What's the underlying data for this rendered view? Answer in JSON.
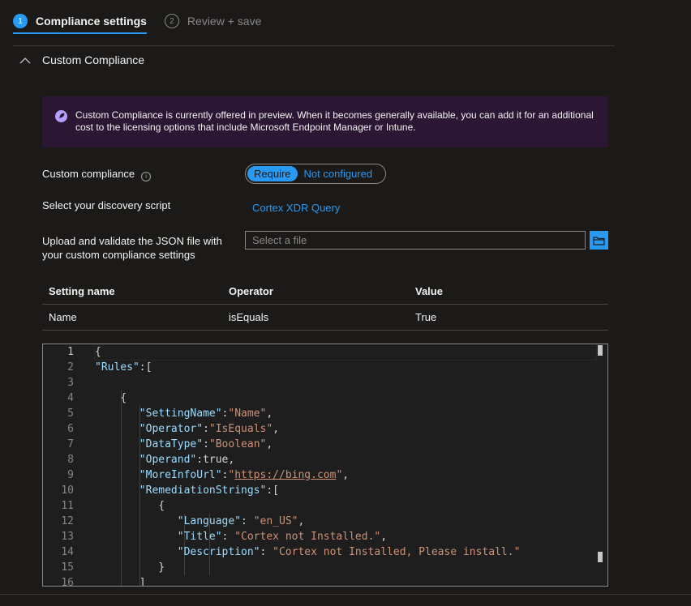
{
  "wizard": {
    "steps": [
      {
        "number": "1",
        "label": "Compliance settings"
      },
      {
        "number": "2",
        "label": "Review + save"
      }
    ]
  },
  "section": {
    "title": "Custom Compliance"
  },
  "banner": {
    "text": "Custom Compliance is currently offered in preview. When it becomes generally available, you can add it for an additional cost to the licensing options that include Microsoft Endpoint Manager or Intune."
  },
  "form": {
    "custom_compliance_label": "Custom compliance",
    "toggle": {
      "on_label": "Require",
      "off_label": "Not configured",
      "selected": "Require"
    },
    "discovery_script_label": "Select your discovery script",
    "discovery_script_value": "Cortex XDR Query",
    "upload_label_line1": "Upload and validate the JSON file with",
    "upload_label_line2": "your custom compliance settings",
    "file_placeholder": "Select a file"
  },
  "table": {
    "headers": [
      "Setting name",
      "Operator",
      "Value"
    ],
    "rows": [
      [
        "Name",
        "isEquals",
        "True"
      ]
    ]
  },
  "editor": {
    "line_numbers": [
      "1",
      "2",
      "3",
      "4",
      "5",
      "6",
      "7",
      "8",
      "9",
      "10",
      "11",
      "12",
      "13",
      "14",
      "15",
      "16"
    ],
    "current_line": "1",
    "lines": {
      "l1": "{",
      "l2_key": "\"Rules\"",
      "l2_rest": ":[",
      "l4": "{",
      "l5_key": "\"SettingName\"",
      "l5_val": "\"Name\"",
      "l6_key": "\"Operator\"",
      "l6_val": "\"IsEquals\"",
      "l7_key": "\"DataType\"",
      "l7_val": "\"Boolean\"",
      "l8_key": "\"Operand\"",
      "l8_val": "true",
      "l9_key": "\"MoreInfoUrl\"",
      "l9_q1": "\"",
      "l9_url": "https://bing.com",
      "l9_q2": "\"",
      "l10_key": "\"RemediationStrings\"",
      "l10_rest": ":[",
      "l11": "{",
      "l12_key": "\"Language\"",
      "l12_val": "\"en_US\"",
      "l13_key": "\"Title\"",
      "l13_val": "\"Cortex not Installed.\"",
      "l14_key": "\"Description\"",
      "l14_val": "\"Cortex not Installed, Please install.\"",
      "l15": "}",
      "l16": "]"
    }
  }
}
